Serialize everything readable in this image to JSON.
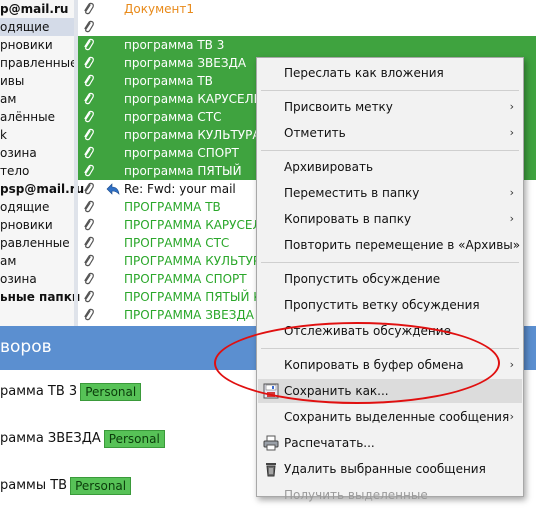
{
  "folders": [
    {
      "label": "p@mail.ru",
      "bold": true,
      "selected": false
    },
    {
      "label": "одящие",
      "bold": false,
      "selected": true
    },
    {
      "label": "рновики",
      "bold": false,
      "selected": false
    },
    {
      "label": "правленные",
      "bold": false,
      "selected": false
    },
    {
      "label": "ивы",
      "bold": false,
      "selected": false
    },
    {
      "label": "ам",
      "bold": false,
      "selected": false
    },
    {
      "label": "алённые",
      "bold": false,
      "selected": false
    },
    {
      "label": "k",
      "bold": false,
      "selected": false
    },
    {
      "label": "озина",
      "bold": false,
      "selected": false
    },
    {
      "label": "тело",
      "bold": false,
      "selected": false
    },
    {
      "label": "psp@mail.ru",
      "bold": true,
      "selected": false
    },
    {
      "label": "одящие",
      "bold": false,
      "selected": false
    },
    {
      "label": "рновики",
      "bold": false,
      "selected": false
    },
    {
      "label": "равленные",
      "bold": false,
      "selected": false
    },
    {
      "label": "ам",
      "bold": false,
      "selected": false
    },
    {
      "label": "озина",
      "bold": false,
      "selected": false
    },
    {
      "label": "ьные папки",
      "bold": true,
      "selected": false
    }
  ],
  "messages": [
    {
      "subject": "Документ1",
      "style": "orange",
      "selected": false,
      "reply": false
    },
    {
      "subject": "",
      "style": "dark",
      "selected": false,
      "reply": false
    },
    {
      "subject": "программа ТВ 3",
      "style": "green",
      "selected": true,
      "reply": false
    },
    {
      "subject": "программа ЗВЕЗДА",
      "style": "green",
      "selected": true,
      "reply": false
    },
    {
      "subject": "программа ТВ",
      "style": "green",
      "selected": true,
      "reply": false
    },
    {
      "subject": "программа КАРУСЕЛЬ",
      "style": "green",
      "selected": true,
      "reply": false
    },
    {
      "subject": "программа СТС",
      "style": "green",
      "selected": true,
      "reply": false
    },
    {
      "subject": "программа КУЛЬТУРА",
      "style": "green",
      "selected": true,
      "reply": false
    },
    {
      "subject": "программа СПОРТ",
      "style": "green",
      "selected": true,
      "reply": false
    },
    {
      "subject": "программа ПЯТЫЙ",
      "style": "green",
      "selected": true,
      "reply": false
    },
    {
      "subject": "Re: Fwd: your mail",
      "style": "dark",
      "selected": false,
      "reply": true
    },
    {
      "subject": "ПРОГРАММА ТВ",
      "style": "green",
      "selected": false,
      "reply": false
    },
    {
      "subject": "ПРОГРАММА КАРУСЕЛЬ",
      "style": "green",
      "selected": false,
      "reply": false
    },
    {
      "subject": "ПРОГРАММА СТС",
      "style": "green",
      "selected": false,
      "reply": false
    },
    {
      "subject": "ПРОГРАММА КУЛЬТУРА",
      "style": "green",
      "selected": false,
      "reply": false
    },
    {
      "subject": "ПРОГРАММА СПОРТ",
      "style": "green",
      "selected": false,
      "reply": false
    },
    {
      "subject": "ПРОГРАММА ПЯТЫЙ КА",
      "style": "green",
      "selected": false,
      "reply": false
    },
    {
      "subject": "ПРОГРАММА ЗВЕЗДА",
      "style": "green",
      "selected": false,
      "reply": false
    }
  ],
  "preview": {
    "header": "воров",
    "lines": [
      {
        "text": "рамма ТВ 3",
        "tag": "Personal"
      },
      {
        "text": "рамма ЗВЕЗДА",
        "tag": "Personal"
      },
      {
        "text": "раммы ТВ",
        "tag": "Personal"
      }
    ]
  },
  "menu": {
    "items": [
      {
        "label": "Переслать как вложения",
        "submenu": false,
        "disabled": false,
        "icon": ""
      },
      {
        "sep": true
      },
      {
        "label": "Присвоить метку",
        "submenu": true,
        "disabled": false,
        "icon": ""
      },
      {
        "label": "Отметить",
        "submenu": true,
        "disabled": false,
        "icon": ""
      },
      {
        "sep": true
      },
      {
        "label": "Архивировать",
        "submenu": false,
        "disabled": false,
        "icon": ""
      },
      {
        "label": "Переместить в папку",
        "submenu": true,
        "disabled": false,
        "icon": ""
      },
      {
        "label": "Копировать в папку",
        "submenu": true,
        "disabled": false,
        "icon": ""
      },
      {
        "label": "Повторить перемещение в «Архивы»",
        "submenu": false,
        "disabled": false,
        "icon": ""
      },
      {
        "sep": true
      },
      {
        "label": "Пропустить обсуждение",
        "submenu": false,
        "disabled": false,
        "icon": ""
      },
      {
        "label": "Пропустить ветку обсуждения",
        "submenu": false,
        "disabled": false,
        "icon": ""
      },
      {
        "label": "Отслеживать обсуждение",
        "submenu": false,
        "disabled": false,
        "icon": ""
      },
      {
        "sep": true
      },
      {
        "label": "Копировать в буфер обмена",
        "submenu": true,
        "disabled": false,
        "icon": ""
      },
      {
        "label": "Сохранить как...",
        "submenu": false,
        "disabled": false,
        "icon": "save-icon",
        "highlight": true
      },
      {
        "label": "Сохранить выделенные сообщения",
        "submenu": true,
        "disabled": false,
        "icon": ""
      },
      {
        "label": "Распечатать...",
        "submenu": false,
        "disabled": false,
        "icon": "printer-icon"
      },
      {
        "label": "Удалить выбранные сообщения",
        "submenu": false,
        "disabled": false,
        "icon": "trash-icon"
      },
      {
        "label": "Получить выделенные",
        "submenu": false,
        "disabled": true,
        "icon": ""
      }
    ],
    "submenu_arrow": "›"
  },
  "colors": {
    "selection": "#3fa33f",
    "green_text": "#2aa72a",
    "orange_text": "#e88a1a",
    "preview_bar": "#5b8fd0",
    "annotation": "#e01010"
  }
}
